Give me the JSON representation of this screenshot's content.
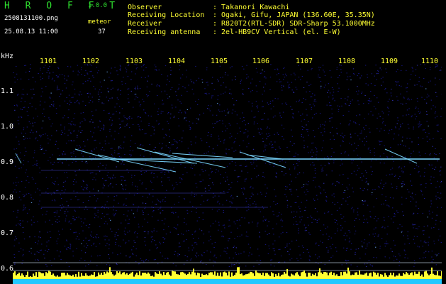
{
  "header": {
    "app_title": "H R O F F T",
    "version": "1.0.0",
    "file_name": "2508131100.png",
    "datetime": "25.08.13 11:00",
    "meteor_label": "meteor",
    "meteor_count": "37"
  },
  "info": [
    {
      "label": "Observer",
      "value": ": Takanori Kawachi"
    },
    {
      "label": "Receiving Location",
      "value": ": Ogaki, Gifu, JAPAN (136.60E, 35.35N)"
    },
    {
      "label": "Receiver",
      "value": ": R820T2(RTL-SDR) SDR-Sharp 53.1000MHz"
    },
    {
      "label": "Receiving antenna",
      "value": ": 2el-HB9CV Vertical (el. E-W)"
    }
  ],
  "axis": {
    "unit": "kHz",
    "time_ticks": [
      "1101",
      "1102",
      "1103",
      "1104",
      "1105",
      "1106",
      "1107",
      "1108",
      "1109",
      "1110"
    ],
    "freq_ticks": [
      "1.1",
      "1.0",
      "0.9",
      "0.8",
      "0.7",
      "0.6"
    ]
  },
  "colors": {
    "background": "#000000",
    "noise": "#1a1a9a",
    "carrier": "#7ad8ff",
    "activity": "#ffff33",
    "baseline": "#22c8ff",
    "title_green": "#2fe02f",
    "yellow": "#ffff33"
  }
}
